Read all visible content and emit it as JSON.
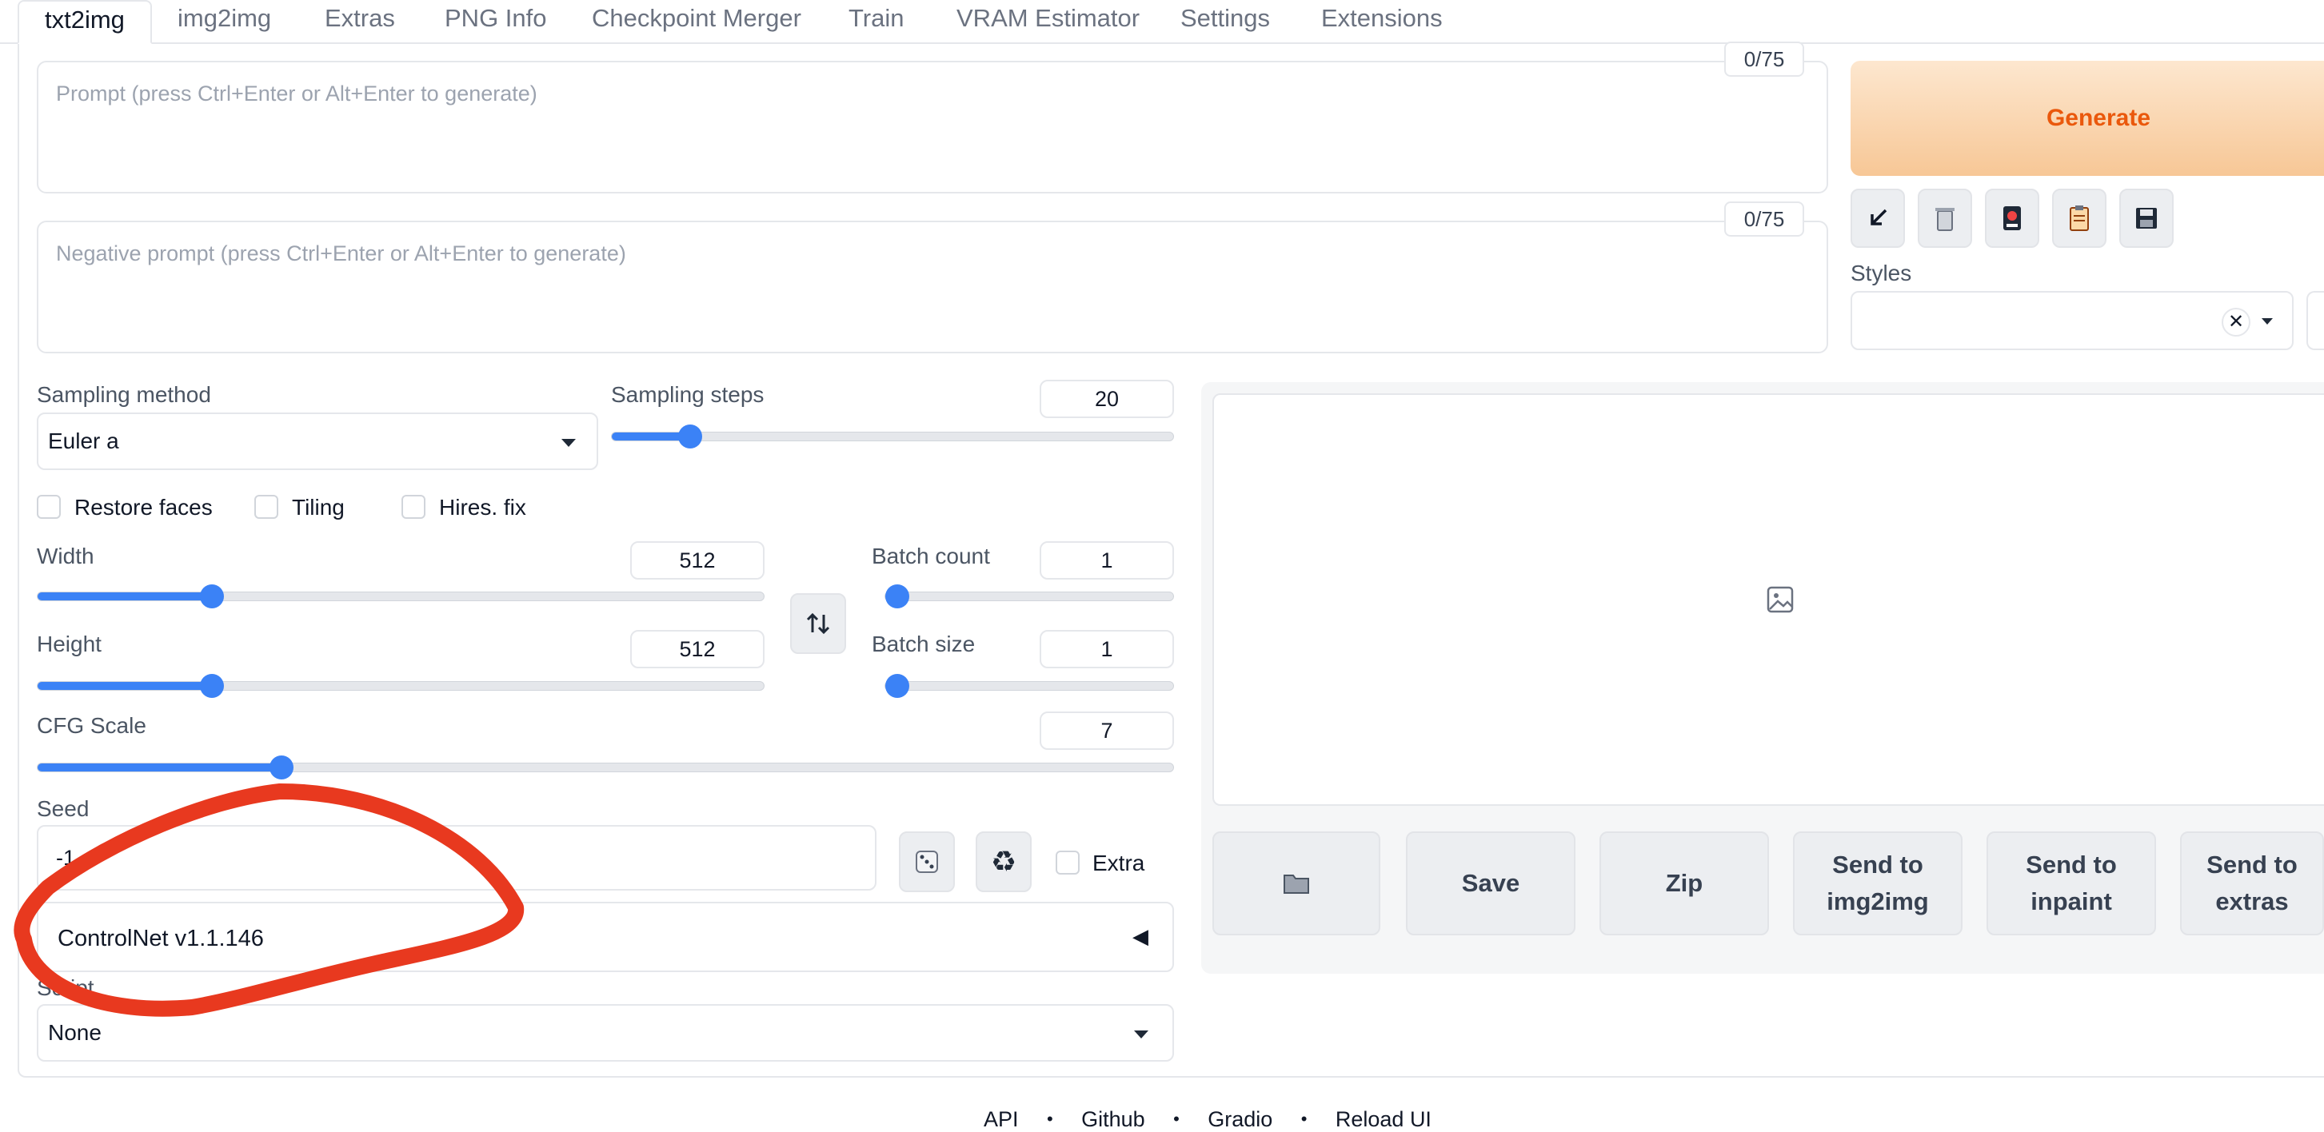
{
  "tabs": [
    "txt2img",
    "img2img",
    "Extras",
    "PNG Info",
    "Checkpoint Merger",
    "Train",
    "VRAM Estimator",
    "Settings",
    "Extensions"
  ],
  "prompt": {
    "placeholder": "Prompt (press Ctrl+Enter or Alt+Enter to generate)",
    "counter": "0/75"
  },
  "negative_prompt": {
    "placeholder": "Negative prompt (press Ctrl+Enter or Alt+Enter to generate)",
    "counter": "0/75"
  },
  "generate_label": "Generate",
  "styles_label": "Styles",
  "sampling": {
    "method_label": "Sampling method",
    "method_value": "Euler a",
    "steps_label": "Sampling steps",
    "steps_value": "20",
    "steps_fraction": 0.14
  },
  "checkboxes": [
    "Restore faces",
    "Tiling",
    "Hires. fix"
  ],
  "width": {
    "label": "Width",
    "value": "512",
    "fraction": 0.24
  },
  "height": {
    "label": "Height",
    "value": "512",
    "fraction": 0.24
  },
  "batch_count": {
    "label": "Batch count",
    "value": "1",
    "fraction": 0.0
  },
  "batch_size": {
    "label": "Batch size",
    "value": "1",
    "fraction": 0.0
  },
  "cfg": {
    "label": "CFG Scale",
    "value": "7",
    "fraction": 0.215
  },
  "seed": {
    "label": "Seed",
    "value": "-1",
    "extra_label": "Extra"
  },
  "controlnet_label": "ControlNet v1.1.146",
  "script": {
    "label": "Script",
    "value": "None"
  },
  "output_buttons": {
    "folder": "",
    "save": "Save",
    "zip": "Zip",
    "img2img": "Send to img2img",
    "inpaint": "Send to inpaint",
    "extras": "Send to extras"
  },
  "footer": [
    "API",
    "Github",
    "Gradio",
    "Reload UI"
  ],
  "colors": {
    "accent": "#3b82f6",
    "generate_text": "#ea580c",
    "annotation": "#e8391f"
  }
}
